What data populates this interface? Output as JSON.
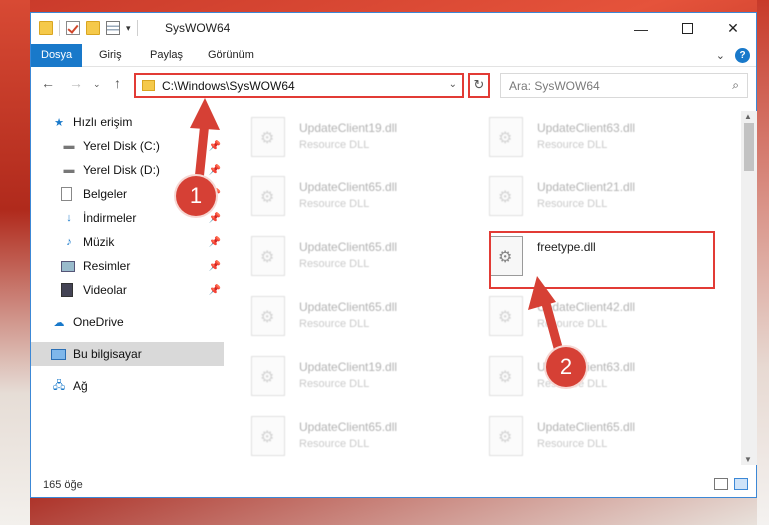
{
  "window": {
    "title": "SysWOW64"
  },
  "ribbon": {
    "tabs": [
      {
        "label": "Dosya",
        "active": true
      },
      {
        "label": "Giriş",
        "active": false
      },
      {
        "label": "Paylaş",
        "active": false
      },
      {
        "label": "Görünüm",
        "active": false
      }
    ],
    "help": "?"
  },
  "address_bar": {
    "path": "C:\\Windows\\SysWOW64"
  },
  "search": {
    "placeholder": "Ara: SysWOW64"
  },
  "nav_pane": {
    "items": [
      {
        "label": "Hızlı erişim",
        "icon": "star-icon"
      },
      {
        "label": "Yerel Disk (C:)",
        "icon": "drive-icon",
        "pinned": true
      },
      {
        "label": "Yerel Disk (D:)",
        "icon": "drive-icon",
        "pinned": true
      },
      {
        "label": "Belgeler",
        "icon": "document-icon",
        "pinned": true
      },
      {
        "label": "İndirmeler",
        "icon": "download-icon",
        "pinned": true
      },
      {
        "label": "Müzik",
        "icon": "music-icon",
        "pinned": true
      },
      {
        "label": "Resimler",
        "icon": "picture-icon",
        "pinned": true
      },
      {
        "label": "Videolar",
        "icon": "video-icon",
        "pinned": true
      },
      {
        "label": "OneDrive",
        "icon": "cloud-icon"
      },
      {
        "label": "Bu bilgisayar",
        "icon": "computer-icon",
        "selected": true
      },
      {
        "label": "Ağ",
        "icon": "network-icon"
      }
    ]
  },
  "files": [
    {
      "name": "UpdateClient19.dll",
      "desc": "Resource DLL"
    },
    {
      "name": "UpdateClient63.dll",
      "desc": "Resource DLL"
    },
    {
      "name": "UpdateClient65.dll",
      "desc": "Resource DLL"
    },
    {
      "name": "UpdateClient21.dll",
      "desc": "Resource DLL"
    },
    {
      "name": "UpdateClient65.dll",
      "desc": "Resource DLL"
    },
    {
      "name": "freetype.dll",
      "desc": ""
    },
    {
      "name": "UpdateClient65.dll",
      "desc": "Resource DLL"
    },
    {
      "name": "UpdateClient42.dll",
      "desc": "Resource DLL"
    },
    {
      "name": "UpdateClient19.dll",
      "desc": "Resource DLL"
    },
    {
      "name": "UpdateClient63.dll",
      "desc": "Resource DLL"
    },
    {
      "name": "UpdateClient65.dll",
      "desc": "Resource DLL"
    },
    {
      "name": "UpdateClient65.dll",
      "desc": "Resource DLL"
    }
  ],
  "status_bar": {
    "count": "165 öğe"
  },
  "annotations": {
    "step1": "1",
    "step2": "2",
    "color": "#e23b35"
  }
}
